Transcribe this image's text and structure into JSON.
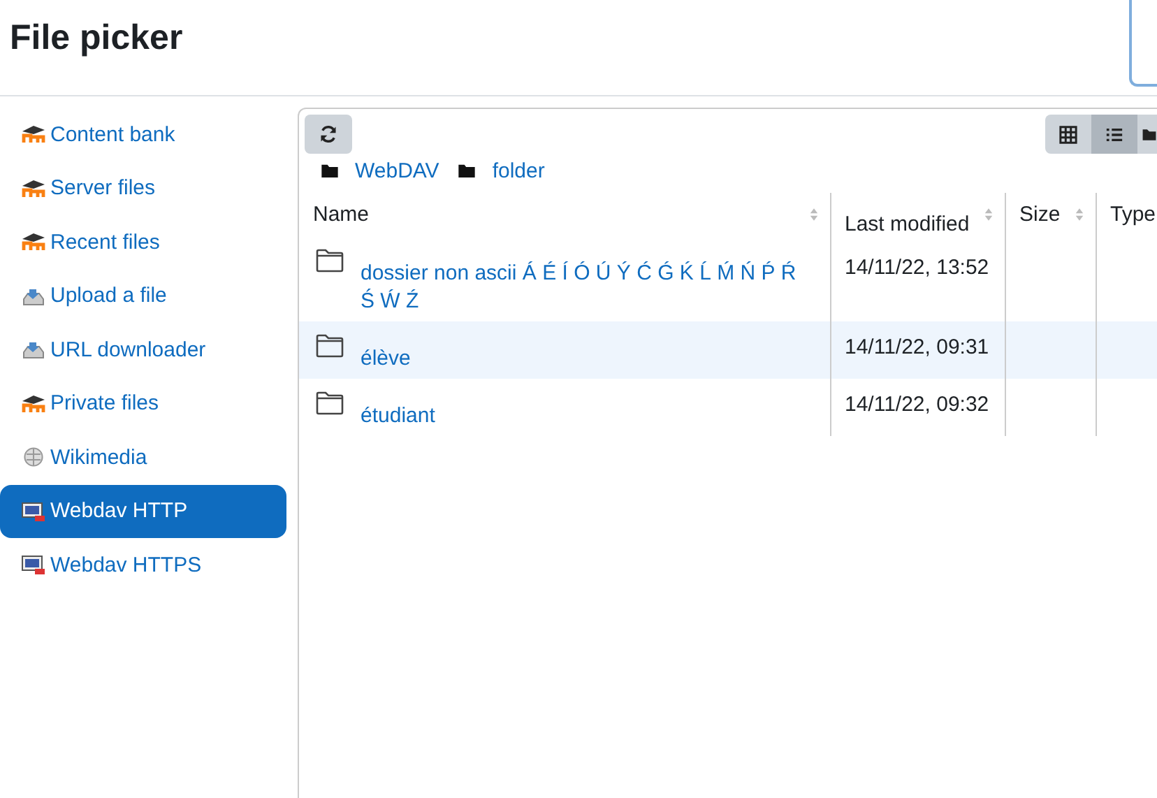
{
  "window": {
    "title": "File picker"
  },
  "sidebar": {
    "items": [
      {
        "label": "Content bank",
        "kind": "moodle",
        "selected": false
      },
      {
        "label": "Server files",
        "kind": "moodle",
        "selected": false
      },
      {
        "label": "Recent files",
        "kind": "moodle",
        "selected": false
      },
      {
        "label": "Upload a file",
        "kind": "upload",
        "selected": false
      },
      {
        "label": "URL downloader",
        "kind": "upload",
        "selected": false
      },
      {
        "label": "Private files",
        "kind": "moodle",
        "selected": false
      },
      {
        "label": "Wikimedia",
        "kind": "wikimedia",
        "selected": false
      },
      {
        "label": "Webdav HTTP",
        "kind": "webdav",
        "selected": true
      },
      {
        "label": "Webdav HTTPS",
        "kind": "webdav",
        "selected": false
      }
    ]
  },
  "toolbar": {
    "views": [
      {
        "kind": "grid",
        "selected": false
      },
      {
        "kind": "list",
        "selected": true
      },
      {
        "kind": "tree",
        "selected": false
      }
    ]
  },
  "breadcrumb": [
    "WebDAV",
    "folder"
  ],
  "table": {
    "columns": [
      "Name",
      "Last modified",
      "Size",
      "Type"
    ],
    "rows": [
      {
        "name": "dossier non ascii Á É Í Ó Ú Ý Ć Ǵ Ḱ Ĺ Ḿ Ń Ṕ Ŕ Ś Ẃ Ź",
        "modified": "14/11/22, 13:52",
        "selected": false
      },
      {
        "name": "élève",
        "modified": "14/11/22, 09:31",
        "selected": true
      },
      {
        "name": "étudiant",
        "modified": "14/11/22, 09:32",
        "selected": false
      }
    ]
  }
}
